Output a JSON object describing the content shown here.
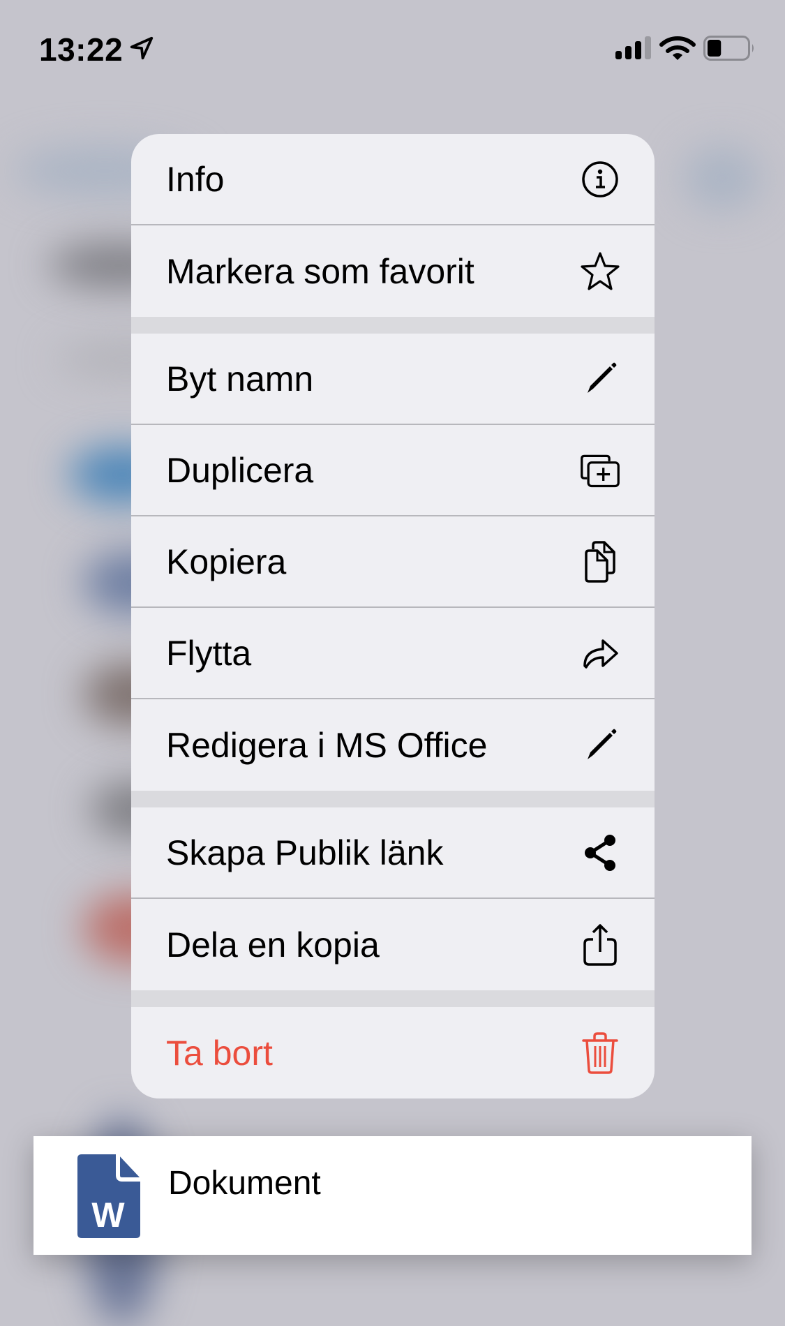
{
  "status_bar": {
    "time": "13:22",
    "location_icon": "location-arrow-icon",
    "signal_bars_active": 3,
    "signal_bars_total": 4,
    "wifi_icon": "wifi-icon",
    "battery_level": 0.35
  },
  "menu": {
    "groups": [
      {
        "items": [
          {
            "label": "Info",
            "icon": "info-circle-icon"
          },
          {
            "label": "Markera som favorit",
            "icon": "star-icon"
          }
        ]
      },
      {
        "items": [
          {
            "label": "Byt namn",
            "icon": "pencil-icon"
          },
          {
            "label": "Duplicera",
            "icon": "duplicate-plus-icon"
          },
          {
            "label": "Kopiera",
            "icon": "copy-docs-icon"
          },
          {
            "label": "Flytta",
            "icon": "move-arrow-icon"
          },
          {
            "label": "Redigera i MS Office",
            "icon": "pencil-icon"
          }
        ]
      },
      {
        "items": [
          {
            "label": "Skapa Publik länk",
            "icon": "share-nodes-icon"
          },
          {
            "label": "Dela en kopia",
            "icon": "share-upload-icon"
          }
        ]
      },
      {
        "items": [
          {
            "label": "Ta bort",
            "icon": "trash-icon",
            "destructive": true
          }
        ]
      }
    ]
  },
  "document": {
    "name": "Dokument",
    "icon": "word-document-icon",
    "icon_letter": "W"
  },
  "colors": {
    "destructive": "#eb4d3d",
    "word_blue": "#3a5a96",
    "menu_bg": "#efeff3",
    "separator_band": "#dadade"
  }
}
